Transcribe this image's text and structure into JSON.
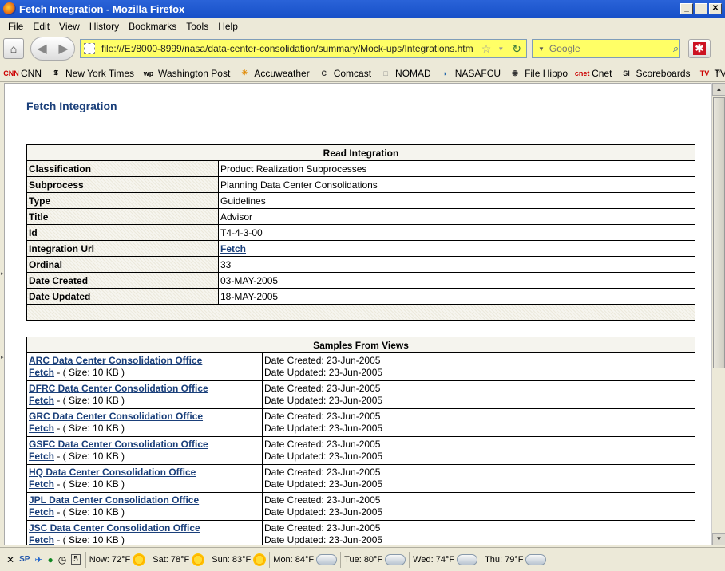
{
  "window": {
    "title": "Fetch Integration - Mozilla Firefox"
  },
  "menu": [
    "File",
    "Edit",
    "View",
    "History",
    "Bookmarks",
    "Tools",
    "Help"
  ],
  "nav": {
    "url": "file:///E:/8000-8999/nasa/data-center-consolidation/summary/Mock-ups/Integrations.htm",
    "search_placeholder": "Google"
  },
  "bookmarks": [
    {
      "label": "CNN",
      "icon": "cnn-icon",
      "glyph": "CNN",
      "color": "#cc0000"
    },
    {
      "label": "New York Times",
      "icon": "nyt-icon",
      "glyph": "𝕿",
      "color": "#000000"
    },
    {
      "label": "Washington Post",
      "icon": "wapo-icon",
      "glyph": "wp",
      "color": "#000000"
    },
    {
      "label": "Accuweather",
      "icon": "accuweather-icon",
      "glyph": "☀",
      "color": "#e08800"
    },
    {
      "label": "Comcast",
      "icon": "comcast-icon",
      "glyph": "C",
      "color": "#333333"
    },
    {
      "label": "NOMAD",
      "icon": "nomad-icon",
      "glyph": "□",
      "color": "#888888"
    },
    {
      "label": "NASAFCU",
      "icon": "nasafcu-icon",
      "glyph": "◗",
      "color": "#2266aa"
    },
    {
      "label": "File Hippo",
      "icon": "filehippo-icon",
      "glyph": "◉",
      "color": "#333333"
    },
    {
      "label": "Cnet",
      "icon": "cnet-icon",
      "glyph": "cnet",
      "color": "#cc0000"
    },
    {
      "label": "Scoreboards",
      "icon": "si-icon",
      "glyph": "SI",
      "color": "#222222"
    },
    {
      "label": "TV Guide",
      "icon": "tvguide-icon",
      "glyph": "TV",
      "color": "#cc0000"
    }
  ],
  "page": {
    "title": "Fetch Integration",
    "read": {
      "header": "Read Integration",
      "rows": [
        {
          "label": "Classification",
          "value": "Product Realization Subprocesses"
        },
        {
          "label": "Subprocess",
          "value": "Planning Data Center Consolidations"
        },
        {
          "label": "Type",
          "value": "Guidelines"
        },
        {
          "label": "Title",
          "value": "Advisor"
        },
        {
          "label": "Id",
          "value": "T4-4-3-00"
        },
        {
          "label": "Integration Url",
          "value": "Fetch",
          "link": true
        },
        {
          "label": "Ordinal",
          "value": "33"
        },
        {
          "label": "Date Created",
          "value": "03-MAY-2005"
        },
        {
          "label": "Date Updated",
          "value": "18-MAY-2005"
        }
      ]
    },
    "samples": {
      "header": "Samples From Views",
      "rows": [
        {
          "office": "ARC Data Center Consolidation Office",
          "fetch": "Fetch",
          "size": " - ( Size: 10 KB )",
          "created": "Date Created: 23-Jun-2005",
          "updated": "Date Updated: 23-Jun-2005"
        },
        {
          "office": "DFRC Data Center Consolidation Office",
          "fetch": "Fetch",
          "size": " - ( Size: 10 KB )",
          "created": "Date Created: 23-Jun-2005",
          "updated": "Date Updated: 23-Jun-2005"
        },
        {
          "office": "GRC Data Center Consolidation Office",
          "fetch": "Fetch",
          "size": " - ( Size: 10 KB )",
          "created": "Date Created: 23-Jun-2005",
          "updated": "Date Updated: 23-Jun-2005"
        },
        {
          "office": "GSFC Data Center Consolidation Office ",
          "fetch": "Fetch",
          "size": " - ( Size: 10 KB )",
          "created": "Date Created: 23-Jun-2005",
          "updated": "Date Updated: 23-Jun-2005"
        },
        {
          "office": "HQ Data Center Consolidation Office ",
          "fetch": "Fetch",
          "size": " - ( Size: 10 KB )",
          "created": "Date Created: 23-Jun-2005",
          "updated": "Date Updated: 23-Jun-2005"
        },
        {
          "office": "JPL Data Center Consolidation Office ",
          "fetch": "Fetch",
          "size": " - ( Size: 10 KB )",
          "created": "Date Created: 23-Jun-2005",
          "updated": "Date Updated: 23-Jun-2005"
        },
        {
          "office": "JSC Data Center Consolidation Office ",
          "fetch": "Fetch",
          "size": " - ( Size: 10 KB )",
          "created": "Date Created: 23-Jun-2005",
          "updated": "Date Updated: 23-Jun-2005"
        }
      ]
    }
  },
  "status": {
    "weather": [
      {
        "label": "Now: 72°F",
        "icon": "sun"
      },
      {
        "label": "Sat: 78°F",
        "icon": "sun"
      },
      {
        "label": "Sun: 83°F",
        "icon": "sun"
      },
      {
        "label": "Mon: 84°F",
        "icon": "partly-cloudy"
      },
      {
        "label": "Tue: 80°F",
        "icon": "partly-cloudy"
      },
      {
        "label": "Wed: 74°F",
        "icon": "cloud"
      },
      {
        "label": "Thu: 79°F",
        "icon": "cloud"
      }
    ]
  }
}
